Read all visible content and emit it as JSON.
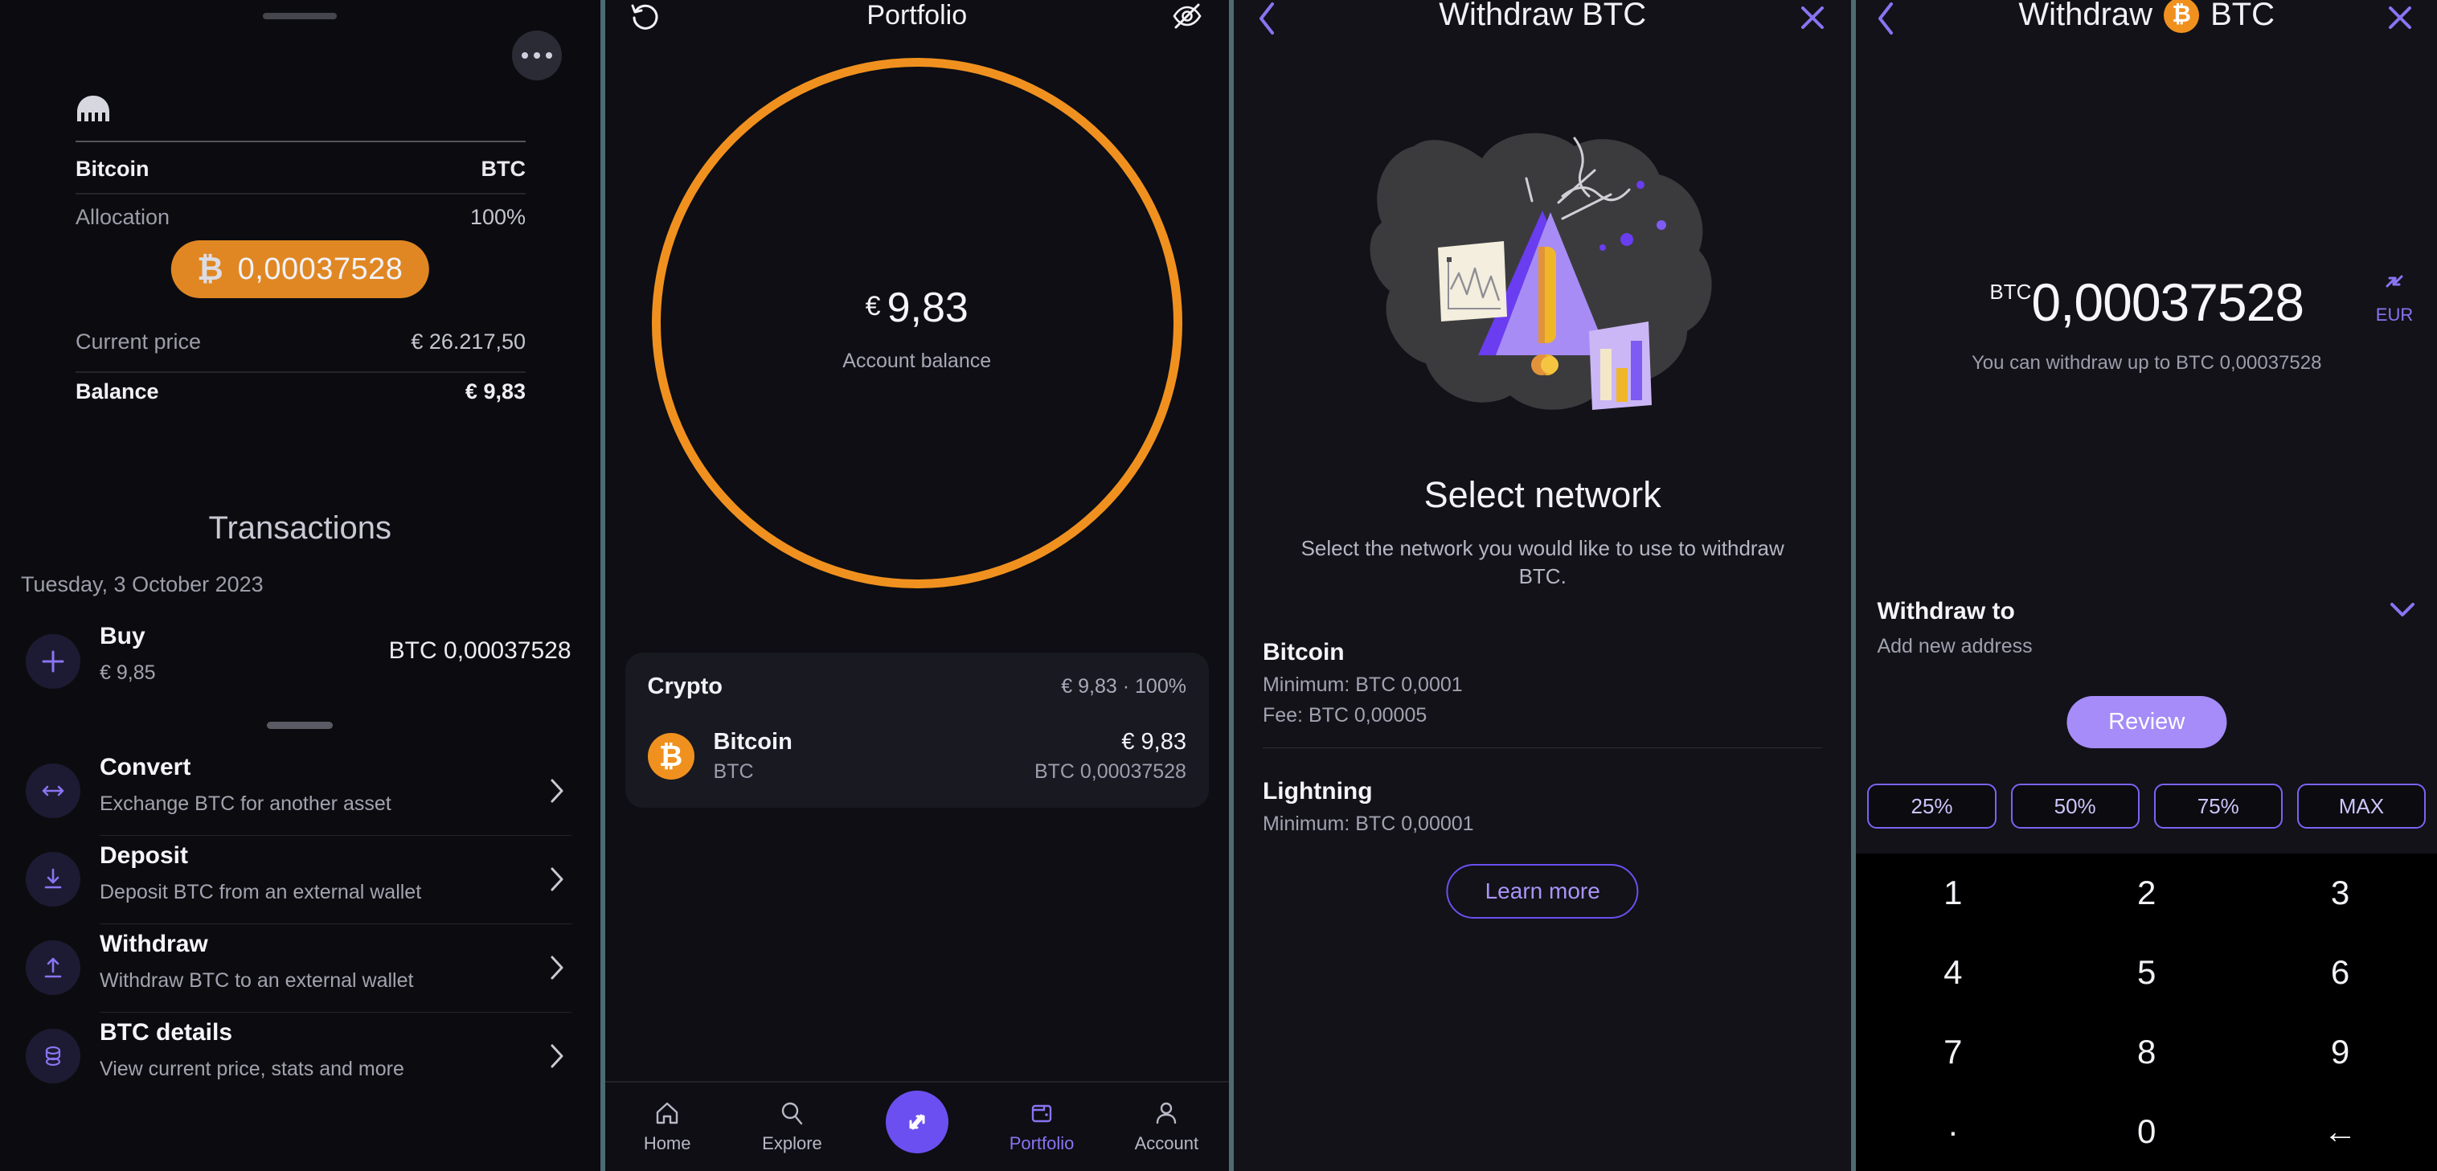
{
  "colors": {
    "accent_purple": "#6c4ff0",
    "accent_purple_light": "#a58cf8",
    "bitcoin_orange": "#f0911f",
    "panel_bg": "#0e0e14",
    "separator": "#4d6b73"
  },
  "panel1": {
    "name": "asset-detail",
    "brand_icon": "kraken-logo",
    "more_button": "more-options-icon",
    "rows": [
      {
        "key": "Bitcoin",
        "value": "BTC"
      },
      {
        "key": "Allocation",
        "value": "100%"
      }
    ],
    "amount_pill": {
      "glyph": "₿",
      "amount": "0,00037528"
    },
    "stats": [
      {
        "key": "Current price",
        "value": "€ 26.217,50"
      },
      {
        "key": "Balance",
        "value": "€ 9,83"
      }
    ],
    "transactions": {
      "heading": "Transactions",
      "date": "Tuesday, 3 October 2023",
      "items": [
        {
          "icon": "plus-icon",
          "title": "Buy",
          "subtitle": "€ 9,85",
          "amount": "BTC 0,00037528"
        }
      ]
    },
    "actions": [
      {
        "icon": "convert-arrows-icon",
        "title": "Convert",
        "subtitle": "Exchange BTC for another asset"
      },
      {
        "icon": "arrow-down-icon",
        "title": "Deposit",
        "subtitle": "Deposit BTC from an external wallet"
      },
      {
        "icon": "arrow-up-icon",
        "title": "Withdraw",
        "subtitle": "Withdraw BTC to an external wallet"
      },
      {
        "icon": "coins-icon",
        "title": "BTC details",
        "subtitle": "View current price, stats and more"
      }
    ]
  },
  "panel2": {
    "name": "portfolio",
    "header": {
      "title": "Portfolio",
      "left_icon": "history-icon",
      "right_icon": "eye-off-icon"
    },
    "donut": {
      "currency": "€",
      "balance": "9,83",
      "label": "Account balance",
      "ring_color": "#f0911f",
      "ring_percent": 100
    },
    "card": {
      "heading": "Crypto",
      "heading_value": "€ 9,83 · 100%",
      "rows": [
        {
          "coin_glyph": "₿",
          "name": "Bitcoin",
          "ticker": "BTC",
          "fiat": "€ 9,83",
          "crypto": "BTC 0,00037528"
        }
      ]
    },
    "navbar": [
      {
        "icon": "home-icon",
        "label": "Home",
        "active": false
      },
      {
        "icon": "search-icon",
        "label": "Explore",
        "active": false
      },
      {
        "icon": "trade-arrows-icon",
        "label": "",
        "active": true
      },
      {
        "icon": "portfolio-icon",
        "label": "Portfolio",
        "active": true
      },
      {
        "icon": "account-icon",
        "label": "Account",
        "active": false
      }
    ]
  },
  "panel3": {
    "name": "select-network",
    "header": {
      "title": "Withdraw BTC",
      "left_icon": "back-chevron-icon",
      "right_icon": "close-icon"
    },
    "illustration": "warning-triangle-charts-illustration",
    "heading": "Select network",
    "subtext": "Select the network you would like to use to withdraw BTC.",
    "networks": [
      {
        "name": "Bitcoin",
        "lines": [
          "Minimum: BTC 0,0001",
          "Fee: BTC 0,00005"
        ]
      },
      {
        "name": "Lightning",
        "lines": [
          "Minimum: BTC 0,00001"
        ]
      }
    ],
    "learn_more": "Learn more"
  },
  "panel4": {
    "name": "withdraw-amount",
    "header": {
      "title_before": "Withdraw",
      "coin_glyph": "₿",
      "title_after": "BTC",
      "left_icon": "back-chevron-icon",
      "right_icon": "close-icon"
    },
    "amount": {
      "ticker": "BTC",
      "value": "0,00037528"
    },
    "available": "You can withdraw up to BTC 0,00037528",
    "switch": {
      "icon": "swap-currency-icon",
      "label": "EUR"
    },
    "withdraw_to": {
      "title": "Withdraw to",
      "subtitle": "Add new address",
      "chevron": "chevron-down-icon"
    },
    "review_button": "Review",
    "percent_chips": [
      "25%",
      "50%",
      "75%",
      "MAX"
    ],
    "keypad": [
      "1",
      "2",
      "3",
      "4",
      "5",
      "6",
      "7",
      "8",
      "9",
      "·",
      "0",
      "←"
    ]
  }
}
